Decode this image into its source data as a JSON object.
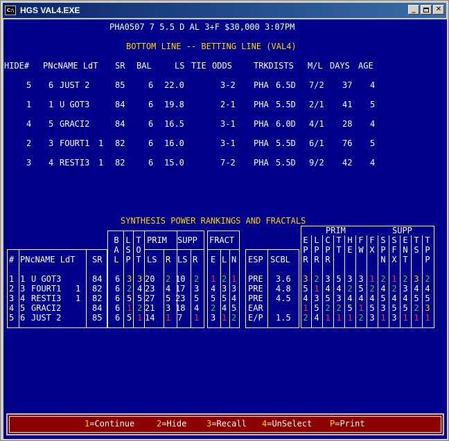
{
  "window": {
    "title": "HGS VAL4.EXE",
    "icon_text": "C:\\"
  },
  "header": {
    "race_info": "PHA0507 7 5.5 D AL 3+F $30,000 3:07PM",
    "section_title": "BOTTOM LINE -- BETTING LINE (VAL4)"
  },
  "bet_table": {
    "columns": [
      "HIDE#",
      "PNcNAME LdT",
      "SR",
      "BAL",
      "LS",
      "TIE",
      "ODDS",
      "TRKDISTS",
      "M/L",
      "DAYS",
      "AGE"
    ],
    "rows": [
      {
        "hide": "5",
        "pn": "6",
        "name": "JUST 2",
        "ldt": "",
        "sr": "85",
        "bal": "6",
        "ls": "22.0",
        "odds": "3-2",
        "trk": "PHA",
        "dist": "6.5D",
        "ml": "7/2",
        "days": "37",
        "age": "4"
      },
      {
        "hide": "1",
        "pn": "1",
        "name": "U GOT3",
        "ldt": "",
        "sr": "84",
        "bal": "6",
        "ls": "19.8",
        "odds": "2-1",
        "trk": "PHA",
        "dist": "5.5D",
        "ml": "2/1",
        "days": "41",
        "age": "5"
      },
      {
        "hide": "4",
        "pn": "5",
        "name": "GRACI2",
        "ldt": "",
        "sr": "84",
        "bal": "6",
        "ls": "16.5",
        "odds": "3-1",
        "trk": "PHA",
        "dist": "6.0D",
        "ml": "4/1",
        "days": "28",
        "age": "4"
      },
      {
        "hide": "2",
        "pn": "3",
        "name": "FOURT1",
        "ldt": "1",
        "sr": "82",
        "bal": "6",
        "ls": "16.0",
        "odds": "3-1",
        "trk": "PHA",
        "dist": "5.5D",
        "ml": "6/1",
        "days": "76",
        "age": "5"
      },
      {
        "hide": "3",
        "pn": "4",
        "name": "RESTI3",
        "ldt": "1",
        "sr": "82",
        "bal": "6",
        "ls": "15.0",
        "odds": "7-2",
        "trk": "PHA",
        "dist": "5.5D",
        "ml": "9/2",
        "days": "42",
        "age": "4"
      }
    ]
  },
  "synthesis": {
    "title": "SYNTHESIS POWER RANKINGS AND FRACTALS",
    "headers": {
      "num": "#",
      "name": "PNcNAME LdT",
      "sr": "SR",
      "prim": "PRIM",
      "supp": "SUPP",
      "fract": "FRACT",
      "esp": "ESP",
      "scbl": "SCBL",
      "prim_top": "PRIM",
      "supp_top": "SUPP",
      "bal": [
        "B",
        "A",
        "L"
      ],
      "lsp": [
        "L",
        "S",
        "P"
      ],
      "tot": [
        "T",
        "O",
        "T"
      ],
      "prim_ls": "LS",
      "prim_r": "R",
      "supp_ls": "LS",
      "supp_r": "R",
      "fr_e": "E",
      "fr_l": "L",
      "fr_n": "N",
      "right_cols": [
        [
          "E",
          "P",
          "R"
        ],
        [
          "L",
          "P",
          "R"
        ],
        [
          "C",
          "P",
          "R"
        ],
        [
          "T",
          "T"
        ],
        [
          "H",
          "E"
        ],
        [
          "F",
          "W"
        ],
        [
          "F",
          "X"
        ],
        [
          "S",
          "P",
          "N"
        ],
        [
          "S",
          "F",
          "X"
        ],
        [
          "E",
          "N",
          "T"
        ],
        [
          "T",
          "S"
        ],
        [
          "T",
          "P",
          "P"
        ]
      ]
    },
    "rows": [
      {
        "num": "1",
        "pn": "1",
        "name": "U GOT3",
        "ldt": "",
        "sr": "84",
        "esp": "PRE",
        "scbl": "3.6",
        "cells": [
          "6",
          "3",
          "3",
          "20",
          "2",
          "10",
          "2",
          "1",
          "2",
          "1"
        ],
        "right": [
          "3",
          "2",
          "3",
          "5",
          "3",
          "3",
          "1",
          "2",
          "1",
          "2",
          "3",
          "2"
        ]
      },
      {
        "num": "2",
        "pn": "3",
        "name": "FOURT1",
        "ldt": "1",
        "sr": "82",
        "esp": "PRE",
        "scbl": "4.8",
        "cells": [
          "6",
          "2",
          "4",
          "23",
          "4",
          "17",
          "3",
          "4",
          "3",
          "3"
        ],
        "right": [
          "5",
          "1",
          "4",
          "4",
          "2",
          "5",
          "2",
          "4",
          "2",
          "3",
          "4",
          "4"
        ]
      },
      {
        "num": "3",
        "pn": "4",
        "name": "RESTI3",
        "ldt": "1",
        "sr": "82",
        "esp": "PRE",
        "scbl": "4.5",
        "cells": [
          "6",
          "5",
          "5",
          "27",
          "5",
          "23",
          "5",
          "5",
          "5",
          "4"
        ],
        "right": [
          "4",
          "3",
          "5",
          "3",
          "4",
          "4",
          "4",
          "5",
          "4",
          "4",
          "5",
          "5"
        ]
      },
      {
        "num": "4",
        "pn": "5",
        "name": "GRACI2",
        "ldt": "",
        "sr": "84",
        "esp": "EAR",
        "scbl": "",
        "cells": [
          "6",
          "1",
          "2",
          "21",
          "3",
          "18",
          "4",
          "2",
          "4",
          "5"
        ],
        "right": [
          "1",
          "5",
          "2",
          "2",
          "5",
          "1",
          "5",
          "3",
          "5",
          "5",
          "2",
          "3"
        ]
      },
      {
        "num": "5",
        "pn": "6",
        "name": "JUST 2",
        "ldt": "",
        "sr": "85",
        "esp": "E/P",
        "scbl": "1.5",
        "cells": [
          "6",
          "5",
          "1",
          "14",
          "1",
          "7",
          "1",
          "3",
          "1",
          "2"
        ],
        "right": [
          "2",
          "4",
          "1",
          "1",
          "1",
          "2",
          "3",
          "1",
          "3",
          "1",
          "1",
          "1"
        ]
      }
    ],
    "colors": {
      "cells": [
        [
          "w",
          "y",
          "y",
          "w",
          "g",
          "w",
          "g",
          "r",
          "g",
          "r"
        ],
        [
          "w",
          "g",
          "w",
          "w",
          "w",
          "w",
          "w",
          "w",
          "w",
          "w"
        ],
        [
          "w",
          "w",
          "w",
          "w",
          "w",
          "w",
          "w",
          "w",
          "w",
          "w"
        ],
        [
          "w",
          "r",
          "g",
          "w",
          "w",
          "w",
          "w",
          "g",
          "w",
          "w"
        ],
        [
          "w",
          "w",
          "r",
          "w",
          "r",
          "w",
          "r",
          "w",
          "r",
          "g"
        ]
      ],
      "right": [
        [
          "y",
          "g",
          "w",
          "w",
          "w",
          "w",
          "r",
          "g",
          "r",
          "g",
          "y",
          "g"
        ],
        [
          "w",
          "r",
          "w",
          "w",
          "g",
          "w",
          "g",
          "w",
          "g",
          "w",
          "w",
          "w"
        ],
        [
          "w",
          "w",
          "w",
          "w",
          "w",
          "w",
          "w",
          "w",
          "w",
          "w",
          "w",
          "w"
        ],
        [
          "r",
          "w",
          "g",
          "g",
          "w",
          "r",
          "w",
          "w",
          "w",
          "w",
          "g",
          "y"
        ],
        [
          "g",
          "w",
          "r",
          "r",
          "r",
          "g",
          "w",
          "r",
          "w",
          "r",
          "r",
          "r"
        ]
      ]
    }
  },
  "footer": {
    "keys": [
      {
        "key": "1",
        "label": "=Continue"
      },
      {
        "key": "2",
        "label": "=Hide"
      },
      {
        "key": "3",
        "label": "=Recall"
      },
      {
        "key": "4",
        "label": "=UnSelect"
      },
      {
        "key": "P",
        "label": "=Print"
      }
    ]
  }
}
